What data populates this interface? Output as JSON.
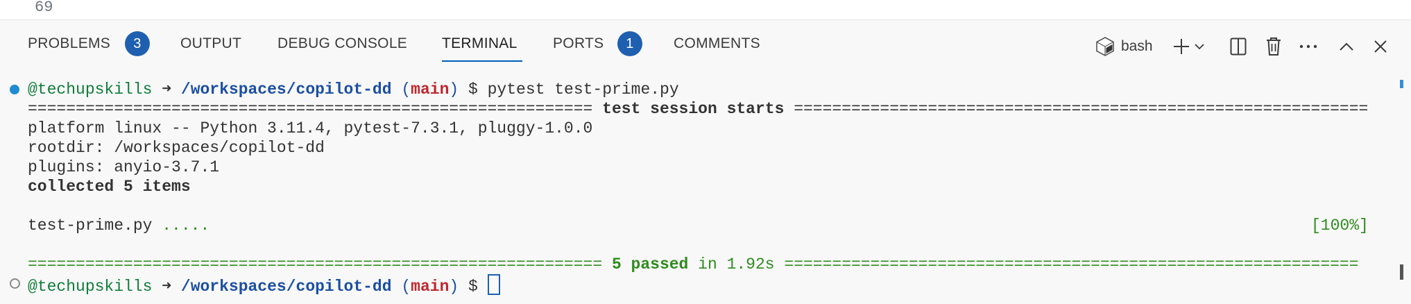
{
  "editor": {
    "line_number": "69"
  },
  "panel": {
    "tabs": [
      {
        "label": "PROBLEMS",
        "badge": "3"
      },
      {
        "label": "OUTPUT"
      },
      {
        "label": "DEBUG CONSOLE"
      },
      {
        "label": "TERMINAL",
        "active": true
      },
      {
        "label": "PORTS",
        "badge": "1"
      },
      {
        "label": "COMMENTS"
      }
    ],
    "actions": {
      "shell_label": "bash",
      "shell_icon": "bash-shell-icon",
      "new_terminal_icon": "plus-icon",
      "dropdown_icon": "chevron-down-icon",
      "split_icon": "split-terminal-icon",
      "kill_icon": "trash-icon",
      "more_icon": "ellipsis-icon",
      "maximize_icon": "chevron-up-icon",
      "close_icon": "close-icon"
    },
    "accent_color": "#005fb8",
    "badge_color": "#1f5fb0"
  },
  "terminal": {
    "prompt1": {
      "user": "@techupskills",
      "arrow": " ➜ ",
      "path": "/workspaces/copilot-dd",
      "branch_open": " (",
      "branch": "main",
      "branch_close": ")",
      "symbol": " $ ",
      "command": "pytest test-prime.py"
    },
    "session_line": {
      "left": "=========================================================== ",
      "text": "test session starts",
      "right": " ============================================================"
    },
    "platform": "platform linux -- Python 3.11.4, pytest-7.3.1, pluggy-1.0.0",
    "rootdir": "rootdir: /workspaces/copilot-dd",
    "plugins": "plugins: anyio-3.7.1",
    "collected": "collected 5 items",
    "result_file": "test-prime.py ",
    "result_dots": ".....",
    "result_percent": "[100%]",
    "summary_line": {
      "left": "============================================================ ",
      "passed": "5 passed",
      "time": " in 1.92s ",
      "right": "============================================================"
    },
    "prompt2": {
      "user": "@techupskills",
      "arrow": " ➜ ",
      "path": "/workspaces/copilot-dd",
      "branch_open": " (",
      "branch": "main",
      "branch_close": ")",
      "symbol": " $ "
    }
  }
}
